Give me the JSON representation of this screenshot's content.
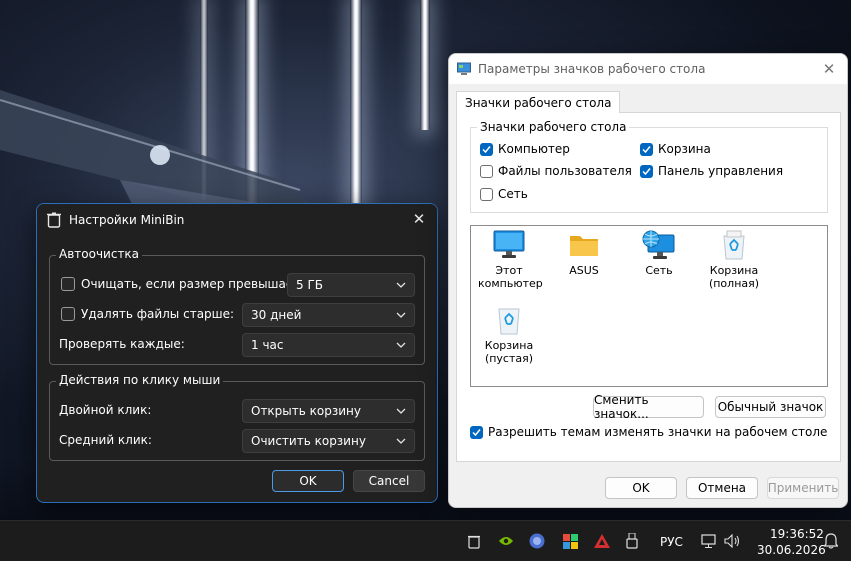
{
  "minibin": {
    "title": "Настройки MiniBin",
    "autoclean_legend": "Автоочистка",
    "clean_if_size_label": "Очищать, если размер превышает:",
    "clean_if_size_checked": false,
    "clean_if_size_value": "5 ГБ",
    "delete_older_label": "Удалять файлы старше:",
    "delete_older_checked": false,
    "delete_older_value": "30 дней",
    "check_every_label": "Проверять каждые:",
    "check_every_value": "1 час",
    "mouse_legend": "Действия по клику мыши",
    "double_click_label": "Двойной клик:",
    "double_click_value": "Открыть корзину",
    "middle_click_label": "Средний клик:",
    "middle_click_value": "Очистить корзину",
    "ok_label": "OK",
    "cancel_label": "Cancel"
  },
  "desktop_icons": {
    "title": "Параметры значков рабочего стола",
    "tab_label": "Значки рабочего стола",
    "group_legend": "Значки рабочего стола",
    "checkboxes": [
      {
        "label": "Компьютер",
        "checked": true
      },
      {
        "label": "Корзина",
        "checked": true
      },
      {
        "label": "Файлы пользователя",
        "checked": false
      },
      {
        "label": "Панель управления",
        "checked": true
      },
      {
        "label": "Сеть",
        "checked": false
      }
    ],
    "icons": [
      {
        "label": "Этот компьютер",
        "icon": "monitor-icon"
      },
      {
        "label": "ASUS",
        "icon": "folder-icon"
      },
      {
        "label": "Сеть",
        "icon": "network-globe-icon"
      },
      {
        "label": "Корзина (полная)",
        "icon": "recycle-bin-full-icon"
      },
      {
        "label": "Корзина (пустая)",
        "icon": "recycle-bin-empty-icon"
      }
    ],
    "change_icon_label": "Сменить значок...",
    "default_icon_label": "Обычный значок",
    "allow_themes_label": "Разрешить темам изменять значки на рабочем столе",
    "allow_themes_checked": true,
    "ok_label": "OK",
    "cancel_label": "Отмена",
    "apply_label": "Применить"
  },
  "taskbar": {
    "language": "РУС",
    "time": "19:36:52",
    "date": "30.06.2026",
    "tray_icons": [
      "minibin-icon",
      "nvidia-icon",
      "app-circle-icon",
      "color-app-icon",
      "red-app-icon",
      "usb-icon",
      "monitor-network-icon",
      "volume-icon",
      "notification-bell-icon"
    ]
  },
  "colors": {
    "accent": "#0067c0",
    "dark_window": "#202020",
    "dark_border": "#2a6fb8"
  }
}
